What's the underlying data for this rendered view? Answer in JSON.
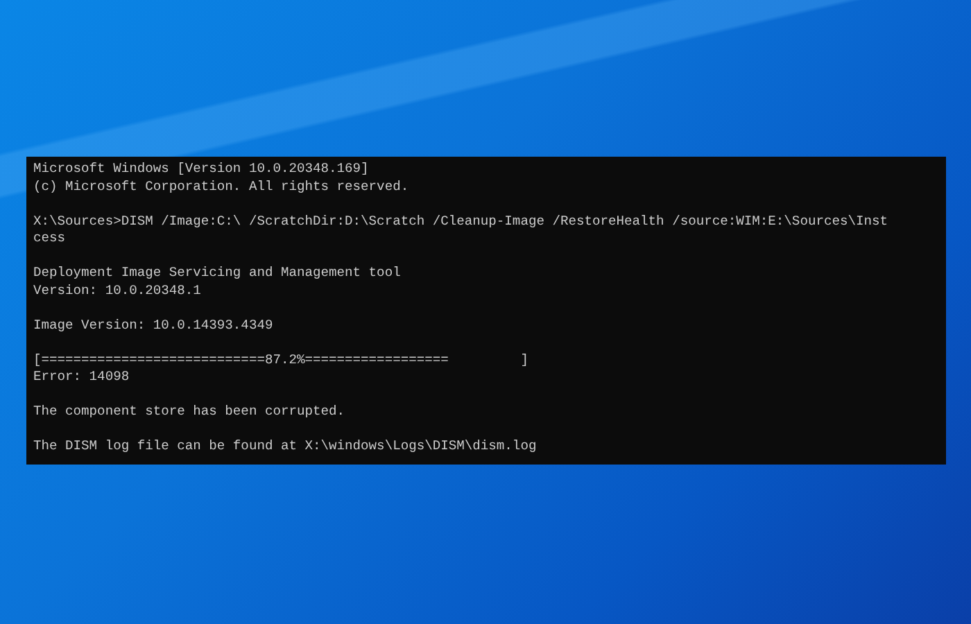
{
  "console": {
    "blocks": [
      [
        "Microsoft Windows [Version 10.0.20348.169]",
        "(c) Microsoft Corporation. All rights reserved."
      ],
      [
        "X:\\Sources>DISM /Image:C:\\ /ScratchDir:D:\\Scratch /Cleanup-Image /RestoreHealth /source:WIM:E:\\Sources\\Inst",
        "cess"
      ],
      [
        "Deployment Image Servicing and Management tool",
        "Version: 10.0.20348.1"
      ],
      [
        "Image Version: 10.0.14393.4349"
      ],
      [
        "[============================87.2%==================         ]",
        "Error: 14098"
      ],
      [
        "The component store has been corrupted."
      ],
      [
        "The DISM log file can be found at X:\\windows\\Logs\\DISM\\dism.log"
      ]
    ]
  }
}
